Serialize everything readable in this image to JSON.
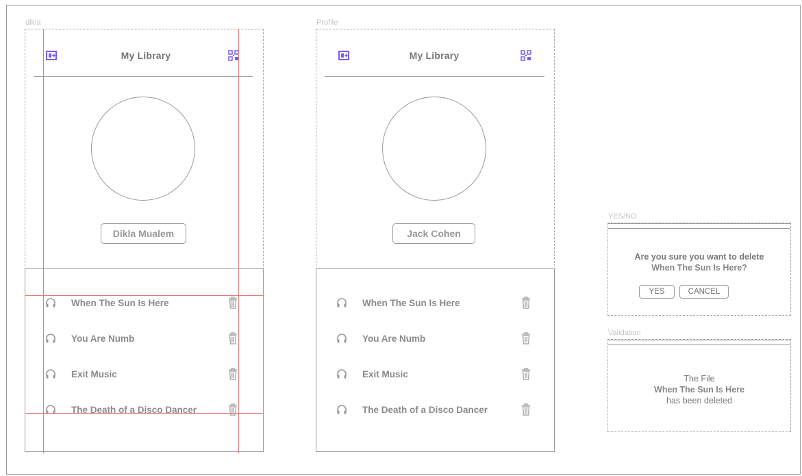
{
  "frames": {
    "left_label": "dikla",
    "middle_label": "Profile",
    "yesno_label": "YES/NO",
    "validation_label": "Validation"
  },
  "header": {
    "title": "My Library",
    "left_icon": "exit-icon",
    "right_icon": "qr-code-icon"
  },
  "accent_color": "#7b5cf0",
  "left_screen": {
    "name": "Dikla Mualem",
    "songs": [
      "When The Sun Is Here",
      "You Are Numb",
      "Exit Music",
      "The Death of a Disco Dancer"
    ]
  },
  "middle_screen": {
    "name": "Jack Cohen",
    "songs": [
      "When The Sun Is Here",
      "You Are Numb",
      "Exit Music",
      "The Death of a Disco Dancer"
    ]
  },
  "yesno": {
    "question_line1": "Are you sure you want to delete",
    "question_line2": "When The Sun Is Here?",
    "yes": "YES",
    "cancel": "CANCEL"
  },
  "validation": {
    "line1": "The File",
    "line2": "When The Sun Is Here",
    "line3": "has been deleted"
  }
}
